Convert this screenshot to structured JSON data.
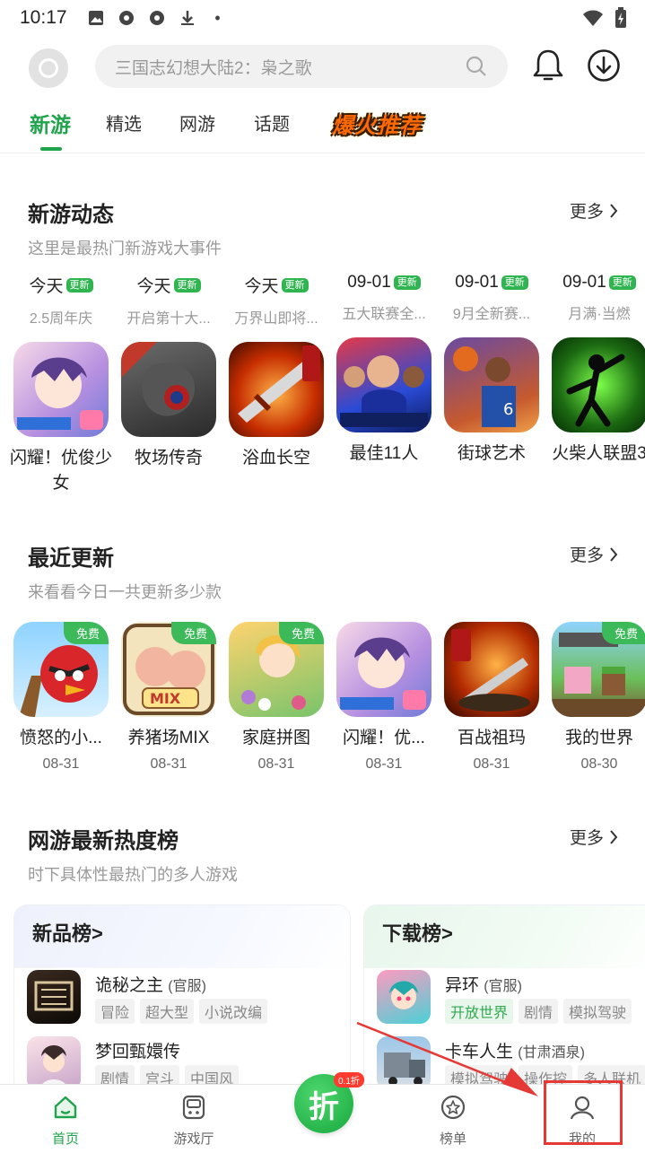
{
  "status_bar": {
    "time": "10:17",
    "dot": "•"
  },
  "header": {
    "search_placeholder": "三国志幻想大陆2：枭之歌",
    "tabs": [
      "新游",
      "精选",
      "网游",
      "话题"
    ],
    "hot_tag": "爆火推荐",
    "active_tab": "新游"
  },
  "sections": {
    "new_games": {
      "title": "新游动态",
      "subtitle": "这里是最热门新游戏大事件",
      "more": "更多"
    },
    "recent": {
      "title": "最近更新",
      "subtitle": "来看看今日一共更新多少款",
      "more": "更多"
    },
    "hot_online": {
      "title": "网游最新热度榜",
      "subtitle": "时下具体性最热门的多人游戏",
      "more": "更多"
    }
  },
  "new_badge": "更新",
  "free_badge": "免费",
  "new_game_events": [
    {
      "date": "今天",
      "event": "2.5周年庆",
      "name": "闪耀！优俊少女"
    },
    {
      "date": "今天",
      "event": "开启第十大...",
      "name": "牧场传奇"
    },
    {
      "date": "今天",
      "event": "万界山即将...",
      "name": "浴血长空"
    },
    {
      "date": "09-01",
      "event": "五大联赛全...",
      "name": "最佳11人"
    },
    {
      "date": "09-01",
      "event": "9月全新赛...",
      "name": "街球艺术"
    },
    {
      "date": "09-01",
      "event": "月满·当燃",
      "name": "火柴人联盟3"
    }
  ],
  "recent_updates": [
    {
      "name": "愤怒的小...",
      "date": "08-31"
    },
    {
      "name": "养猪场MIX",
      "date": "08-31"
    },
    {
      "name": "家庭拼图",
      "date": "08-31"
    },
    {
      "name": "闪耀！优...",
      "date": "08-31"
    },
    {
      "name": "百战祖玛",
      "date": "08-31"
    },
    {
      "name": "我的世界",
      "date": "08-30"
    }
  ],
  "rank_new": {
    "title": "新品榜>",
    "items": [
      {
        "name": "诡秘之主",
        "sub": "(官服)",
        "tags": [
          "冒险",
          "超大型",
          "小说改编"
        ]
      },
      {
        "name": "梦回甄嬛传",
        "sub": "",
        "tags": [
          "剧情",
          "宫斗",
          "中国风"
        ]
      }
    ]
  },
  "rank_download": {
    "title": "下载榜>",
    "items": [
      {
        "name": "异环",
        "sub": "(官服)",
        "tags": [
          "开放世界",
          "剧情",
          "模拟驾驶"
        ]
      },
      {
        "name": "卡车人生",
        "sub": "(甘肃酒泉)",
        "tags": [
          "模拟驾驶",
          "操作控",
          "多人联机"
        ]
      }
    ]
  },
  "bottom_nav": {
    "home": "首页",
    "hall": "游戏厅",
    "center": "折",
    "center_badge": "0.1折",
    "rank": "榜单",
    "mine": "我的"
  },
  "colors": {
    "accent": "#1fa34b",
    "badge": "#2fb54f",
    "annotation": "#e53935"
  }
}
